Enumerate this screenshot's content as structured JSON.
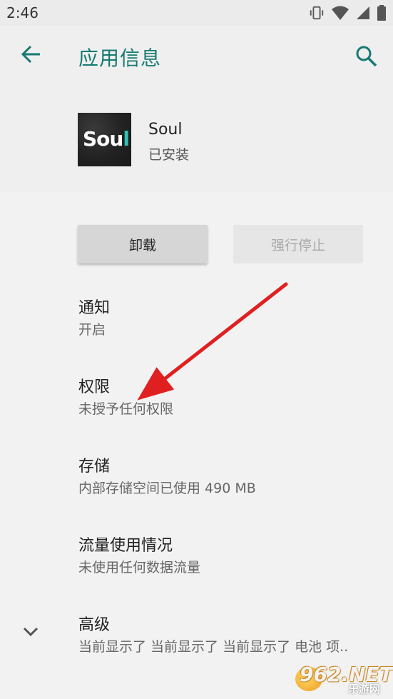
{
  "status_bar": {
    "time": "2:46",
    "icons": [
      "vibrate-icon",
      "wifi-icon",
      "signal-icon",
      "battery-icon"
    ]
  },
  "header": {
    "title": "应用信息",
    "back_icon": "arrow-back-icon",
    "search_icon": "search-icon"
  },
  "app": {
    "name": "Soul",
    "status": "已安装",
    "icon_text_main": "Sou",
    "icon_text_accent": "l"
  },
  "buttons": {
    "uninstall": "卸载",
    "force_stop": "强行停止"
  },
  "settings": [
    {
      "title": "通知",
      "subtitle": "开启"
    },
    {
      "title": "权限",
      "subtitle": "未授予任何权限"
    },
    {
      "title": "存储",
      "subtitle": "内部存储空间已使用 490 MB"
    },
    {
      "title": "流量使用情况",
      "subtitle": "未使用任何数据流量"
    },
    {
      "title": "高级",
      "subtitle": "当前显示了 当前显示了 当前显示了 电池 项.."
    }
  ],
  "watermark": {
    "main": "962.NET",
    "sub": "乐游网"
  },
  "colors": {
    "accent": "#167a72",
    "arrow": "#e02020",
    "background": "#f2f2f2"
  }
}
